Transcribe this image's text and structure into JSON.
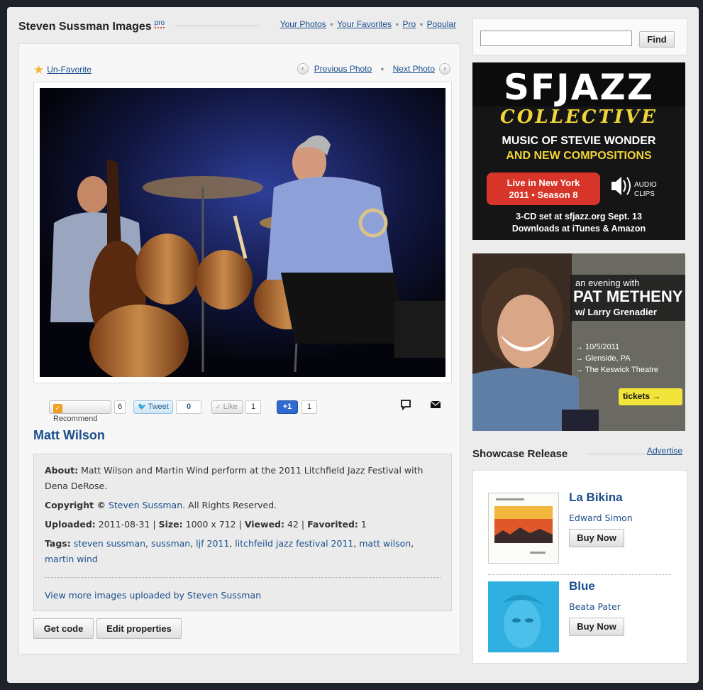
{
  "header": {
    "site_title": "Steven Sussman Images",
    "pro_badge": "pro",
    "nav": [
      "Your Photos",
      "Your Favorites",
      "Pro",
      "Popular"
    ]
  },
  "photo_page": {
    "favorite_label": "Un-Favorite",
    "prev_label": "Previous Photo",
    "next_label": "Next Photo",
    "title": "Matt Wilson",
    "social": {
      "recommend_label": "Recommend",
      "recommend_count": "6",
      "tweet_label": "Tweet",
      "tweet_count": "0",
      "like_label": "Like",
      "like_count": "1",
      "plusone_label": "+1",
      "plusone_count": "1"
    },
    "about_label": "About:",
    "about_text": "Matt Wilson and Martin Wind perform at the 2011 Litchfield Jazz Festival with Dena DeRose.",
    "copyright_label": "Copyright ©",
    "copyright_owner": "Steven Sussman",
    "copyright_suffix": ". All Rights Reserved.",
    "uploaded_label": "Uploaded:",
    "uploaded_value": "2011-08-31",
    "size_label": "Size:",
    "size_value": "1000 x 712",
    "viewed_label": "Viewed:",
    "viewed_value": "42",
    "favorited_label": "Favorited:",
    "favorited_value": "1",
    "tags_label": "Tags:",
    "tags": [
      "steven sussman",
      "sussman",
      "ljf 2011",
      "litchfeild jazz festival 2011",
      "matt wilson",
      "martin wind"
    ],
    "more_link": "View more images uploaded by Steven Sussman",
    "get_code_label": "Get code",
    "edit_label": "Edit properties"
  },
  "sidebar": {
    "search_value": "",
    "find_label": "Find",
    "ad1": {
      "line1": "SFJAZZ",
      "line2": "COLLECTIVE",
      "line3": "MUSIC OF STEVIE WONDER",
      "line4": "AND NEW COMPOSITIONS",
      "badge1": "Live in New York",
      "badge2": "2011 • Season 8",
      "audio1": "AUDIO",
      "audio2": "CLIPS",
      "footer1": "3-CD set at sfjazz.org Sept. 13",
      "footer2": "Downloads at iTunes & Amazon"
    },
    "ad2": {
      "intro": "an evening with",
      "headliner": "PAT METHENY",
      "guest": "w/ Larry Grenadier",
      "date": "→ 10/5/2011",
      "city": "→ Glenside, PA",
      "venue": "→ The Keswick Theatre",
      "tickets": "tickets →"
    },
    "showcase_title": "Showcase Release",
    "advertise_label": "Advertise",
    "releases": [
      {
        "name": "La Bikina",
        "artist": "Edward Simon",
        "buy": "Buy Now"
      },
      {
        "name": "Blue",
        "artist": "Beata Pater",
        "buy": "Buy Now"
      }
    ]
  },
  "colors": {
    "link": "#1a4e8c",
    "page_bg": "#1e2329",
    "panel_bg": "#ececec",
    "ad_red": "#d8352a",
    "ad_yellow": "#f0d43a",
    "ticket_yellow": "#f3e43a"
  }
}
